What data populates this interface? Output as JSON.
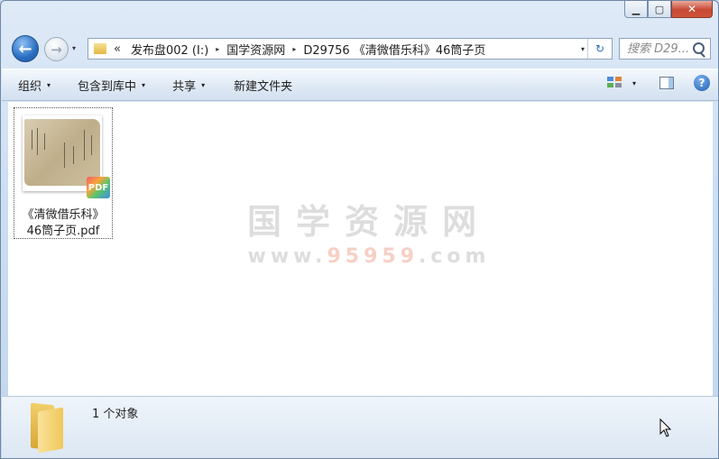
{
  "window": {
    "caption": {
      "minimize": "▁",
      "maximize": "▢",
      "close": "✕"
    }
  },
  "nav": {
    "back": "←",
    "forward": "→",
    "history_dropdown": "▾",
    "address_chevrons": "«",
    "breadcrumbs": [
      "发布盘002 (I:)",
      "国学资源网",
      "D29756 《清微借乐科》46筒子页"
    ],
    "crumb_separator": "▸",
    "address_dropdown": "▾",
    "refresh": "↻",
    "search_placeholder": "搜索 D29..."
  },
  "toolbar": {
    "organize": "组织",
    "include_library": "包含到库中",
    "share": "共享",
    "new_folder": "新建文件夹",
    "dropdown_arrow": "▾",
    "help": "?"
  },
  "file": {
    "name_line1": "《清微借乐科》",
    "name_line2": "46筒子页.pdf",
    "badge": "PDF"
  },
  "watermark": {
    "title": "国学资源网",
    "url_prefix": "www.",
    "url_number": "95959",
    "url_suffix": ".com"
  },
  "status": {
    "item_count": "1 个对象"
  }
}
